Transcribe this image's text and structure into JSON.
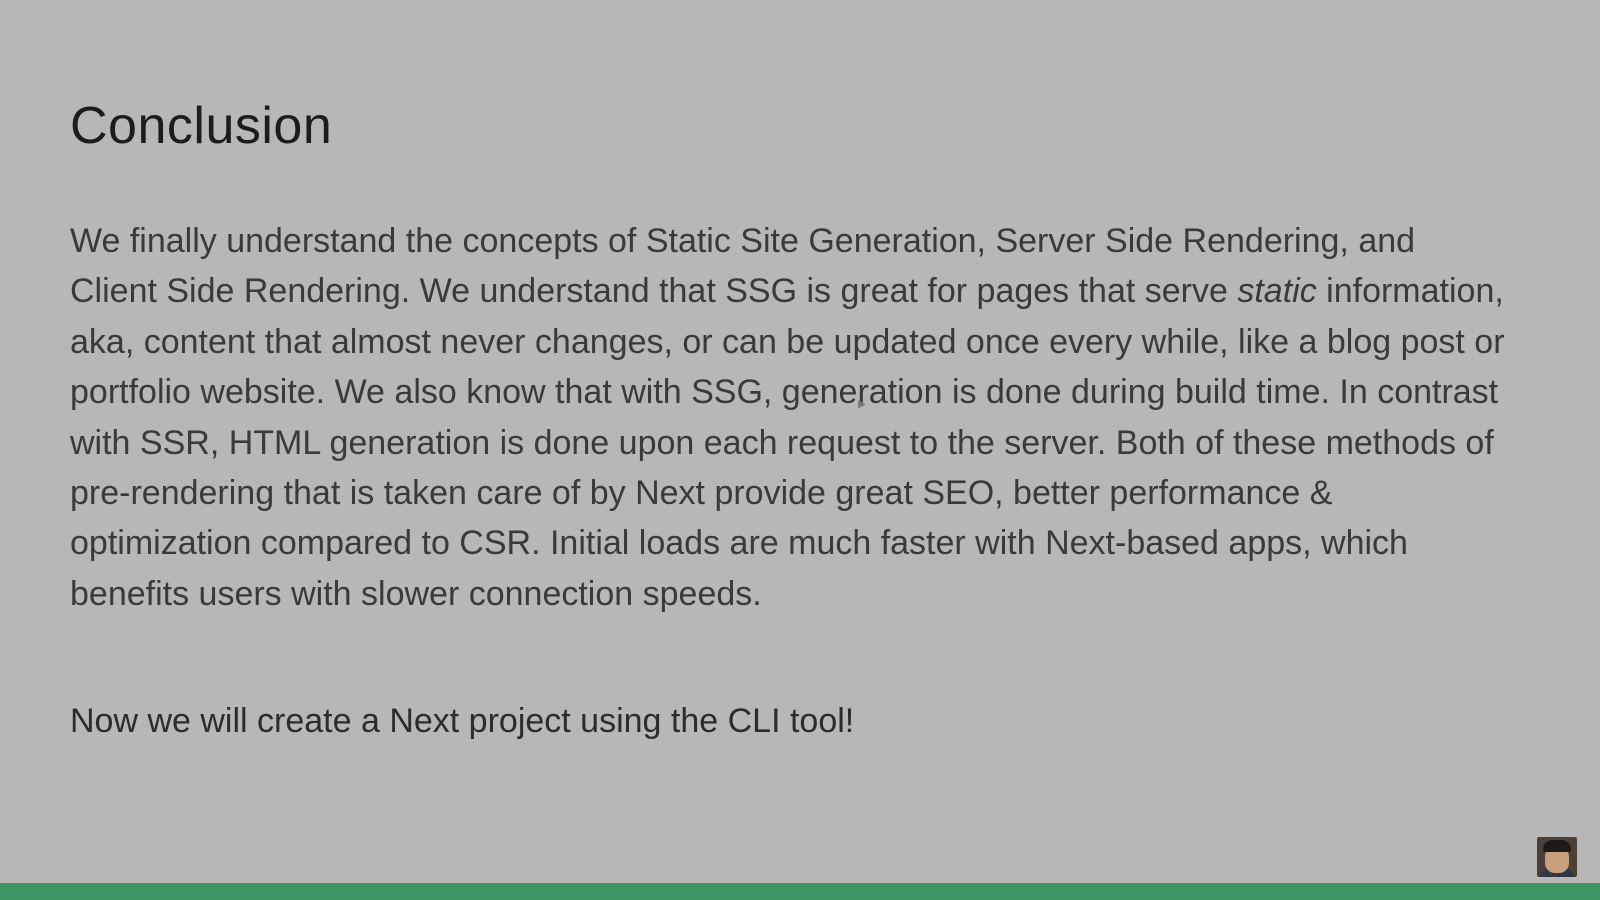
{
  "slide": {
    "title": "Conclusion",
    "paragraph": {
      "before_italic": "We finally understand the concepts of Static Site Generation, Server Side Rendering, and Client Side Rendering. We understand that SSG is great for pages that serve ",
      "italic": "static",
      "after_italic": " information, aka, content that almost never changes, or can be updated once every while, like a blog post or portfolio website. We also know that with SSG, generation is done during build time. In contrast with SSR, HTML generation is done upon each request to the server. Both of these methods of pre-rendering that is taken care of by Next provide great SEO, better performance & optimization compared to CSR. Initial loads are much faster with Next-based apps, which benefits users with slower connection speeds."
    },
    "followup": "Now we will create a Next project using the CLI tool!"
  },
  "progress": {
    "fraction": 1.0,
    "color": "#3e9665"
  },
  "colors": {
    "background": "#b7b7b7",
    "title": "#1c1c1c",
    "body": "#3a3a3a"
  },
  "icons": {
    "cursor": "mouse-pointer-icon",
    "presenter": "presenter-webcam"
  }
}
